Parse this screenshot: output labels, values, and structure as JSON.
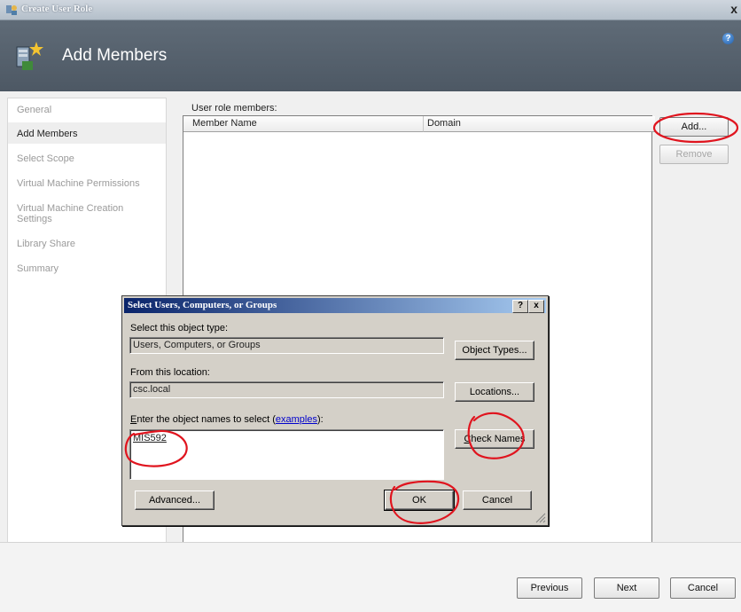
{
  "window": {
    "title": "Create User Role",
    "close_glyph": "x"
  },
  "header": {
    "title": "Add Members",
    "help_glyph": "?"
  },
  "nav": {
    "items": [
      "General",
      "Add Members",
      "Select Scope",
      "Virtual Machine Permissions",
      "Virtual Machine Creation Settings",
      "Library Share",
      "Summary"
    ],
    "active": "Add Members"
  },
  "members": {
    "label": "User role members:",
    "columns": [
      "Member Name",
      "Domain"
    ],
    "add_label": "Add...",
    "remove_label": "Remove"
  },
  "footer": {
    "previous_label": "Previous",
    "next_label": "Next",
    "cancel_label": "Cancel"
  },
  "dialog": {
    "title": "Select Users, Computers, or Groups",
    "help_glyph": "?",
    "close_glyph": "x",
    "object_type_label": "Select this object type:",
    "object_type_value": "Users, Computers, or Groups",
    "object_types_button": "Object Types...",
    "location_label": "From this location:",
    "location_value": "csc.local",
    "locations_button": "Locations...",
    "names_label_underline": "E",
    "names_label_rest": "nter the object names to select (",
    "examples_link": "examples",
    "names_label_end": "):",
    "names_value": "MIS592",
    "check_names_underline": "C",
    "check_names_rest": "heck Names",
    "advanced_label": "Advanced...",
    "ok_label": "OK",
    "cancel_label": "Cancel"
  },
  "colors": {
    "header_bg": "#56616d",
    "dialog_title": "#0a246a",
    "annotation": "#e0141e"
  }
}
